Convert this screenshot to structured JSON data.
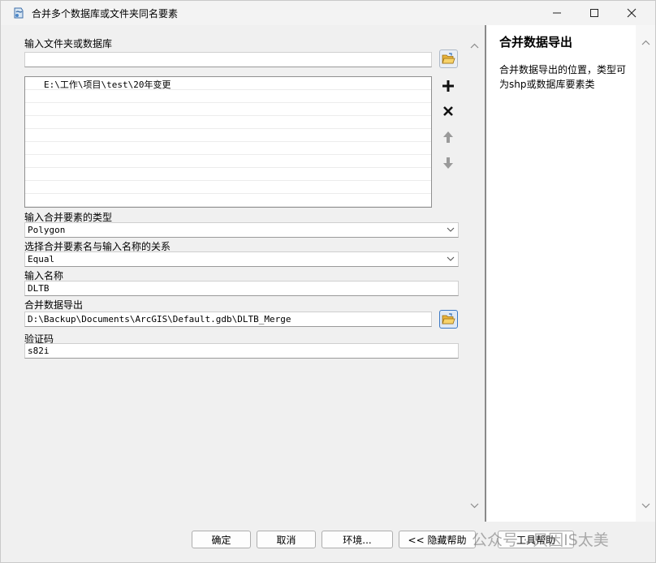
{
  "window": {
    "title": "合并多个数据库或文件夹同名要素",
    "minimize_icon": "minimize-icon",
    "maximize_icon": "maximize-icon",
    "close_icon": "close-icon"
  },
  "form": {
    "input_folder": {
      "label": "输入文件夹或数据库",
      "value": ""
    },
    "input_list": {
      "items": [
        "E:\\工作\\项目\\test\\20年变更",
        "",
        "",
        "",
        "",
        "",
        "",
        "",
        "",
        ""
      ]
    },
    "merge_type": {
      "label": "输入合并要素的类型",
      "value": "Polygon"
    },
    "relation": {
      "label": "选择合并要素名与输入名称的关系",
      "value": "Equal"
    },
    "input_name": {
      "label": "输入名称",
      "value": "DLTB"
    },
    "output": {
      "label": "合并数据导出",
      "value": "D:\\Backup\\Documents\\ArcGIS\\Default.gdb\\DLTB_Merge"
    },
    "verify": {
      "label": "验证码",
      "value": "s82i"
    }
  },
  "help": {
    "title": "合并数据导出",
    "body": "合并数据导出的位置，类型可为shp或数据库要素类"
  },
  "buttons": {
    "ok": "确定",
    "cancel": "取消",
    "environment": "环境...",
    "hide_help": "<< 隐藏帮助",
    "tool_help": "工具帮助"
  },
  "watermark": "公众号 · 只因IS太美",
  "colors": {
    "folder_yellow": "#e8b33c",
    "accent_blue": "#2f6db5"
  }
}
